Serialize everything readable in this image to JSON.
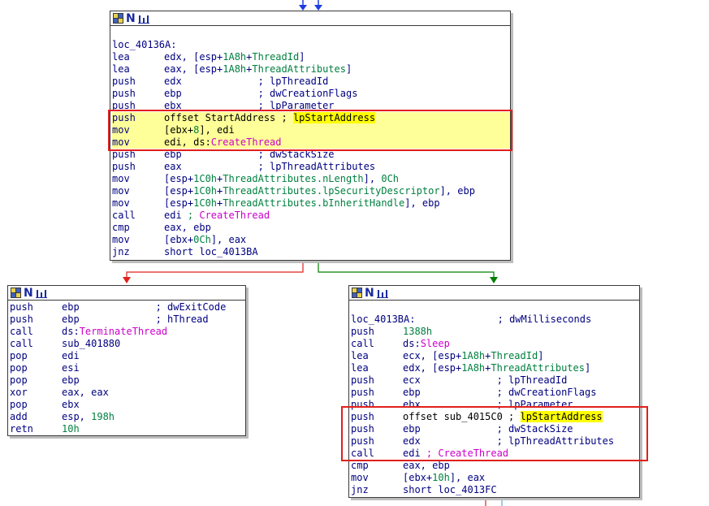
{
  "colors": {
    "true_edge": "#008000",
    "false_edge": "#e0201c",
    "flow_edge": "#1f3ce0",
    "selection": "#e0201c",
    "highlight": "#ffff99",
    "label_navy": "#000080",
    "number_green": "#008040",
    "import_magenta": "#cc00cc"
  },
  "icons": {
    "graph": "graph-view-icon",
    "name": "node-name-icon",
    "chart": "node-chart-icon"
  },
  "nodes": {
    "top": {
      "label": "loc_40136A:",
      "lines": [
        {
          "mn": "lea",
          "op": [
            [
              "navy",
              "edx, [esp+"
            ],
            [
              "green",
              "1A8h"
            ],
            [
              "navy",
              "+"
            ],
            [
              "green",
              "ThreadId"
            ],
            [
              "navy",
              "]"
            ]
          ]
        },
        {
          "mn": "lea",
          "op": [
            [
              "navy",
              "eax, [esp+"
            ],
            [
              "green",
              "1A8h"
            ],
            [
              "navy",
              "+"
            ],
            [
              "green",
              "ThreadAttributes"
            ],
            [
              "navy",
              "]"
            ]
          ]
        },
        {
          "mn": "push",
          "op": [
            [
              "navy",
              "edx             ; lpThreadId"
            ]
          ]
        },
        {
          "mn": "push",
          "op": [
            [
              "navy",
              "ebp             ; dwCreationFlags"
            ]
          ]
        },
        {
          "mn": "push",
          "op": [
            [
              "navy",
              "ebx             ; lpParameter"
            ]
          ]
        },
        {
          "mn": "push",
          "hl": true,
          "op": [
            [
              "black",
              "offset StartAddress ; "
            ],
            [
              "hl",
              "lpStartAddress"
            ]
          ]
        },
        {
          "mn": "mov",
          "hl": true,
          "op": [
            [
              "black",
              "[ebx+"
            ],
            [
              "green",
              "8"
            ],
            [
              "black",
              "], edi"
            ]
          ]
        },
        {
          "mn": "mov",
          "hl": true,
          "op": [
            [
              "black",
              "edi, ds:"
            ],
            [
              "magenta",
              "CreateThread"
            ]
          ]
        },
        {
          "mn": "push",
          "op": [
            [
              "navy",
              "ebp             ; dwStackSize"
            ]
          ]
        },
        {
          "mn": "push",
          "op": [
            [
              "navy",
              "eax             ; lpThreadAttributes"
            ]
          ]
        },
        {
          "mn": "mov",
          "op": [
            [
              "navy",
              "[esp+"
            ],
            [
              "green",
              "1C0h"
            ],
            [
              "navy",
              "+"
            ],
            [
              "green",
              "ThreadAttributes.nLength"
            ],
            [
              "navy",
              "], "
            ],
            [
              "green",
              "0Ch"
            ]
          ]
        },
        {
          "mn": "mov",
          "op": [
            [
              "navy",
              "[esp+"
            ],
            [
              "green",
              "1C0h"
            ],
            [
              "navy",
              "+"
            ],
            [
              "green",
              "ThreadAttributes.lpSecurityDescriptor"
            ],
            [
              "navy",
              "], ebp"
            ]
          ]
        },
        {
          "mn": "mov",
          "op": [
            [
              "navy",
              "[esp+"
            ],
            [
              "green",
              "1C0h"
            ],
            [
              "navy",
              "+"
            ],
            [
              "green",
              "ThreadAttributes.bInheritHandle"
            ],
            [
              "navy",
              "], ebp"
            ]
          ]
        },
        {
          "mn": "call",
          "op": [
            [
              "navy",
              "edi "
            ],
            [
              "green",
              "; "
            ],
            [
              "magenta",
              "CreateThread"
            ]
          ]
        },
        {
          "mn": "cmp",
          "op": [
            [
              "navy",
              "eax, ebp"
            ]
          ]
        },
        {
          "mn": "mov",
          "op": [
            [
              "navy",
              "[ebx+"
            ],
            [
              "green",
              "0Ch"
            ],
            [
              "navy",
              "], eax"
            ]
          ]
        },
        {
          "mn": "jnz",
          "op": [
            [
              "navy",
              "short loc_4013BA"
            ]
          ]
        }
      ]
    },
    "left": {
      "lines": [
        {
          "mn": "push",
          "op": [
            [
              "navy",
              "ebp             ; dwExitCode"
            ]
          ]
        },
        {
          "mn": "push",
          "op": [
            [
              "navy",
              "ebp             ; hThread"
            ]
          ]
        },
        {
          "mn": "call",
          "op": [
            [
              "navy",
              "ds:"
            ],
            [
              "magenta",
              "TerminateThread"
            ]
          ]
        },
        {
          "mn": "call",
          "op": [
            [
              "navy",
              "sub_401880"
            ]
          ]
        },
        {
          "mn": "pop",
          "op": [
            [
              "navy",
              "edi"
            ]
          ]
        },
        {
          "mn": "pop",
          "op": [
            [
              "navy",
              "esi"
            ]
          ]
        },
        {
          "mn": "pop",
          "op": [
            [
              "navy",
              "ebp"
            ]
          ]
        },
        {
          "mn": "xor",
          "op": [
            [
              "navy",
              "eax, eax"
            ]
          ]
        },
        {
          "mn": "pop",
          "op": [
            [
              "navy",
              "ebx"
            ]
          ]
        },
        {
          "mn": "add",
          "op": [
            [
              "navy",
              "esp, "
            ],
            [
              "green",
              "198h"
            ]
          ]
        },
        {
          "mn": "retn",
          "op": [
            [
              "green",
              "10h"
            ]
          ]
        }
      ]
    },
    "right": {
      "label": "loc_4013BA:              ; dwMilliseconds",
      "lines": [
        {
          "mn": "push",
          "op": [
            [
              "green",
              "1388h"
            ]
          ]
        },
        {
          "mn": "call",
          "op": [
            [
              "navy",
              "ds:"
            ],
            [
              "magenta",
              "Sleep"
            ]
          ]
        },
        {
          "mn": "lea",
          "op": [
            [
              "navy",
              "ecx, [esp+"
            ],
            [
              "green",
              "1A8h"
            ],
            [
              "navy",
              "+"
            ],
            [
              "green",
              "ThreadId"
            ],
            [
              "navy",
              "]"
            ]
          ]
        },
        {
          "mn": "lea",
          "op": [
            [
              "navy",
              "edx, [esp+"
            ],
            [
              "green",
              "1A8h"
            ],
            [
              "navy",
              "+"
            ],
            [
              "green",
              "ThreadAttributes"
            ],
            [
              "navy",
              "]"
            ]
          ]
        },
        {
          "mn": "push",
          "op": [
            [
              "navy",
              "ecx             ; lpThreadId"
            ]
          ]
        },
        {
          "mn": "push",
          "op": [
            [
              "navy",
              "ebp             ; dwCreationFlags"
            ]
          ]
        },
        {
          "mn": "push",
          "op": [
            [
              "navy",
              "ebx             ; lpParameter"
            ]
          ]
        },
        {
          "mn": "push",
          "op": [
            [
              "black",
              "offset sub_4015C0 ; "
            ],
            [
              "hl",
              "lpStartAddress"
            ]
          ]
        },
        {
          "mn": "push",
          "op": [
            [
              "navy",
              "ebp             ; dwStackSize"
            ]
          ]
        },
        {
          "mn": "push",
          "op": [
            [
              "navy",
              "edx             ; lpThreadAttributes"
            ]
          ]
        },
        {
          "mn": "call",
          "op": [
            [
              "navy",
              "edi "
            ],
            [
              "magenta",
              "; CreateThread"
            ]
          ]
        },
        {
          "mn": "cmp",
          "op": [
            [
              "navy",
              "eax, ebp"
            ]
          ]
        },
        {
          "mn": "mov",
          "op": [
            [
              "navy",
              "[ebx+"
            ],
            [
              "green",
              "10h"
            ],
            [
              "navy",
              "], eax"
            ]
          ]
        },
        {
          "mn": "jnz",
          "op": [
            [
              "navy",
              "short loc_4013FC"
            ]
          ]
        }
      ]
    }
  }
}
